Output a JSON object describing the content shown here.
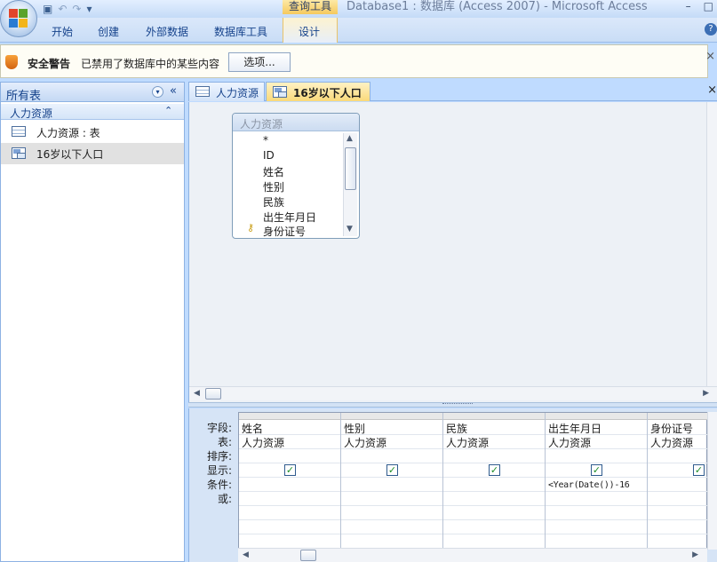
{
  "title_bar": {
    "context_tab_head": "查询工具",
    "app_title": "Database1 : 数据库 (Access 2007) - Microsoft Access",
    "minimize": "–",
    "restore": "□",
    "help": "?"
  },
  "ribbon": {
    "tabs": [
      "开始",
      "创建",
      "外部数据",
      "数据库工具",
      "设计"
    ]
  },
  "security_bar": {
    "title": "安全警告",
    "message": "已禁用了数据库中的某些内容",
    "options_button": "选项...",
    "close": "×"
  },
  "nav_pane": {
    "title": "所有表",
    "dropdown_icon": "▾",
    "collapse_icon": "«",
    "group": {
      "title": "人力资源",
      "toggle_icon": "⌃",
      "items": [
        {
          "label": "人力资源 : 表",
          "icon": "table-icon",
          "selected": false
        },
        {
          "label": "16岁以下人口",
          "icon": "query-icon",
          "selected": true
        }
      ]
    }
  },
  "document_tabs": {
    "tabs": [
      {
        "label": "人力资源",
        "icon": "table-icon",
        "active": false
      },
      {
        "label": "16岁以下人口",
        "icon": "query-icon",
        "active": true
      }
    ],
    "close": "×"
  },
  "field_list": {
    "title": "人力资源",
    "fields": [
      "*",
      "ID",
      "姓名",
      "性别",
      "民族",
      "出生年月日",
      "身份证号"
    ],
    "key_field": "身份证号"
  },
  "design_grid": {
    "row_labels": [
      "字段:",
      "表:",
      "排序:",
      "显示:",
      "条件:",
      "或:"
    ],
    "columns": [
      {
        "field": "姓名",
        "table": "人力资源",
        "show": true,
        "criteria": ""
      },
      {
        "field": "性别",
        "table": "人力资源",
        "show": true,
        "criteria": ""
      },
      {
        "field": "民族",
        "table": "人力资源",
        "show": true,
        "criteria": ""
      },
      {
        "field": "出生年月日",
        "table": "人力资源",
        "show": true,
        "criteria": "<Year(Date())-16"
      },
      {
        "field": "身份证号",
        "table": "人力资源",
        "show": true,
        "criteria": ""
      }
    ]
  }
}
